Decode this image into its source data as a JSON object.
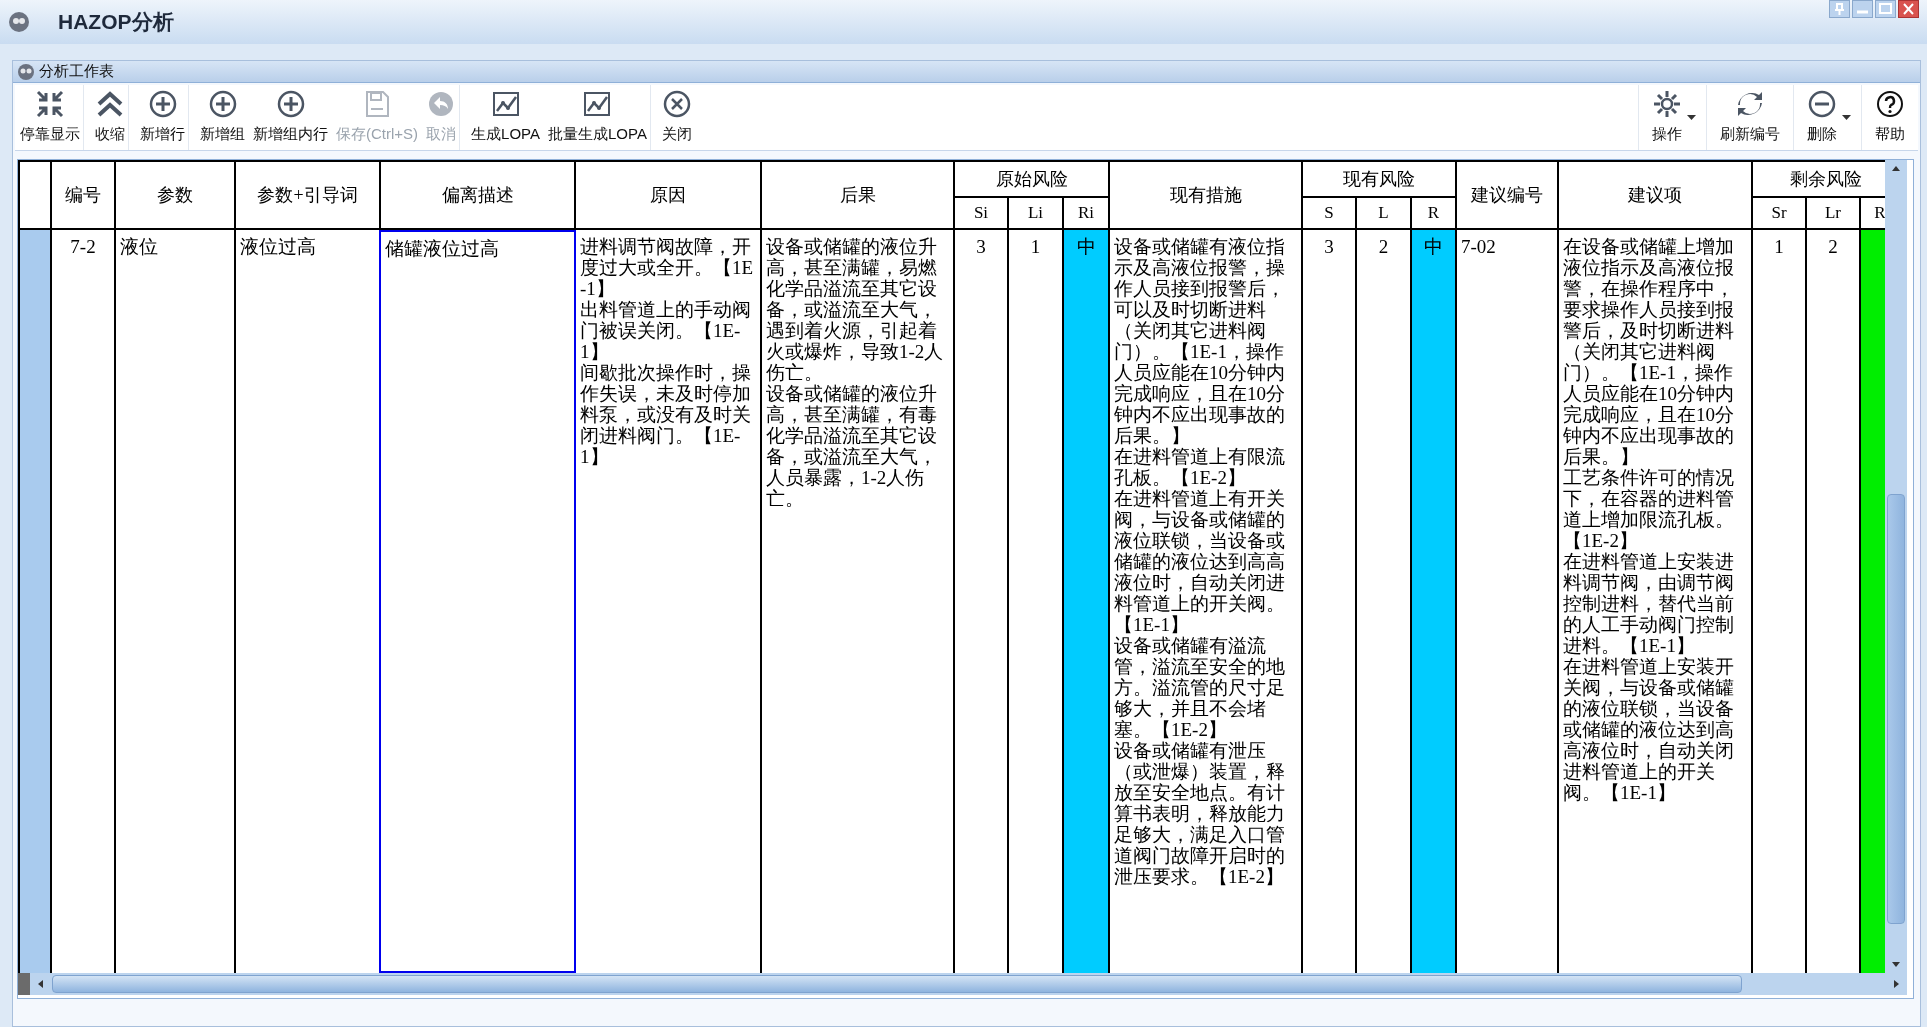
{
  "window": {
    "title": "HAZOP分析"
  },
  "panel": {
    "title": "分析工作表"
  },
  "toolbar": {
    "left": [
      {
        "label": "停靠显示",
        "disabled": false,
        "dropdown": false
      },
      {
        "label": "收缩",
        "disabled": false,
        "dropdown": false
      },
      {
        "label": "新增行",
        "disabled": false,
        "dropdown": false
      },
      {
        "label": "新增组",
        "disabled": false,
        "dropdown": false
      },
      {
        "label": "新增组内行",
        "disabled": false,
        "dropdown": false
      },
      {
        "label": "保存(Ctrl+S)",
        "disabled": true,
        "dropdown": false
      },
      {
        "label": "取消",
        "disabled": true,
        "dropdown": false
      },
      {
        "label": "生成LOPA",
        "disabled": false,
        "dropdown": false
      },
      {
        "label": "批量生成LOPA",
        "disabled": false,
        "dropdown": false
      },
      {
        "label": "关闭",
        "disabled": false,
        "dropdown": false
      }
    ],
    "right": [
      {
        "label": "操作",
        "disabled": false,
        "dropdown": true
      },
      {
        "label": "刷新编号",
        "disabled": false,
        "dropdown": false
      },
      {
        "label": "删除",
        "disabled": false,
        "dropdown": true
      },
      {
        "label": "帮助",
        "disabled": false,
        "dropdown": false
      }
    ]
  },
  "table": {
    "column_groups": [
      {
        "label": "原始风险"
      },
      {
        "label": "现有风险"
      },
      {
        "label": "剩余风险"
      }
    ],
    "columns": [
      {
        "label": "编号",
        "grouped": false
      },
      {
        "label": "参数",
        "grouped": false
      },
      {
        "label": "参数+引导词",
        "grouped": false
      },
      {
        "label": "偏离描述",
        "grouped": false
      },
      {
        "label": "原因",
        "grouped": false
      },
      {
        "label": "后果",
        "grouped": false
      },
      {
        "label": "Si",
        "grouped": true
      },
      {
        "label": "Li",
        "grouped": true
      },
      {
        "label": "Ri",
        "grouped": true
      },
      {
        "label": "现有措施",
        "grouped": false
      },
      {
        "label": "S",
        "grouped": true
      },
      {
        "label": "L",
        "grouped": true
      },
      {
        "label": "R",
        "grouped": true
      },
      {
        "label": "建议编号",
        "grouped": false
      },
      {
        "label": "建议项",
        "grouped": false
      },
      {
        "label": "Sr",
        "grouped": true
      },
      {
        "label": "Lr",
        "grouped": true
      },
      {
        "label": "R",
        "grouped": true
      }
    ],
    "rows": [
      {
        "cells": [
          {
            "kind": "center",
            "text": "7-2",
            "selected": false
          },
          {
            "kind": "text",
            "text": "液位",
            "selected": false
          },
          {
            "kind": "text",
            "text": "液位过高",
            "selected": false
          },
          {
            "kind": "text",
            "text": "储罐液位过高",
            "selected": true
          },
          {
            "kind": "paragraphs",
            "paragraphs": [
              "进料调节阀故障，开度过大或全开。【1E-1】",
              "出料管道上的手动阀门被误关闭。【1E-1】",
              "间歇批次操作时，操作失误，未及时停加料泵，或没有及时关闭进料阀门。【1E-1】"
            ],
            "selected": false
          },
          {
            "kind": "paragraphs",
            "paragraphs": [
              "设备或储罐的液位升高，甚至满罐，易燃化学品溢流至其它设备，或溢流至大气，遇到着火源，引起着火或爆炸，导致1-2人伤亡。",
              "设备或储罐的液位升高，甚至满罐，有毒化学品溢流至其它设备，或溢流至大气，人员暴露，1-2人伤亡。"
            ],
            "selected": false
          },
          {
            "kind": "center",
            "text": "3",
            "selected": false
          },
          {
            "kind": "center",
            "text": "1",
            "selected": false
          },
          {
            "kind": "risk",
            "text": "中",
            "color": "#00ccff",
            "selected": false
          },
          {
            "kind": "paragraphs",
            "paragraphs": [
              "设备或储罐有液位指示及高液位报警，操作人员接到报警后，可以及时切断进料（关闭其它进料阀门）。【1E-1，操作人员应能在10分钟内完成响应，且在10分钟内不应出现事故的后果。】",
              "在进料管道上有限流孔板。【1E-2】",
              "在进料管道上有开关阀，与设备或储罐的液位联锁，当设备或储罐的液位达到高高液位时，自动关闭进料管道上的开关阀。【1E-1】",
              "设备或储罐有溢流管，溢流至安全的地方。溢流管的尺寸足够大，并且不会堵塞。【1E-2】",
              "设备或储罐有泄压（或泄爆）装置，释放至安全地点。有计算书表明，释放能力足够大，满足入口管道阀门故障开启时的泄压要求。【1E-2】"
            ],
            "selected": false
          },
          {
            "kind": "center",
            "text": "3",
            "selected": false
          },
          {
            "kind": "center",
            "text": "2",
            "selected": false
          },
          {
            "kind": "risk",
            "text": "中",
            "color": "#00ccff",
            "selected": false
          },
          {
            "kind": "text",
            "text": "7-02",
            "selected": false
          },
          {
            "kind": "paragraphs",
            "paragraphs": [
              "在设备或储罐上增加液位指示及高液位报警，在操作程序中，要求操作人员接到报警后，及时切断进料（关闭其它进料阀门）。【1E-1，操作人员应能在10分钟内完成响应，且在10分钟内不应出现事故的后果。】",
              "工艺条件许可的情况下，在容器的进料管道上增加限流孔板。【1E-2】",
              "在进料管道上安装进料调节阀，由调节阀控制进料，替代当前的人工手动阀门控制进料。【1E-1】",
              "在进料管道上安装开关阀，与设备或储罐的液位联锁，当设备或储罐的液位达到高高液位时，自动关闭进料管道上的开关阀。【1E-1】"
            ],
            "selected": false
          },
          {
            "kind": "center",
            "text": "1",
            "selected": false
          },
          {
            "kind": "center",
            "text": "2",
            "selected": false
          },
          {
            "kind": "risk",
            "color": "#00ee00",
            "selected": false
          }
        ]
      }
    ]
  }
}
